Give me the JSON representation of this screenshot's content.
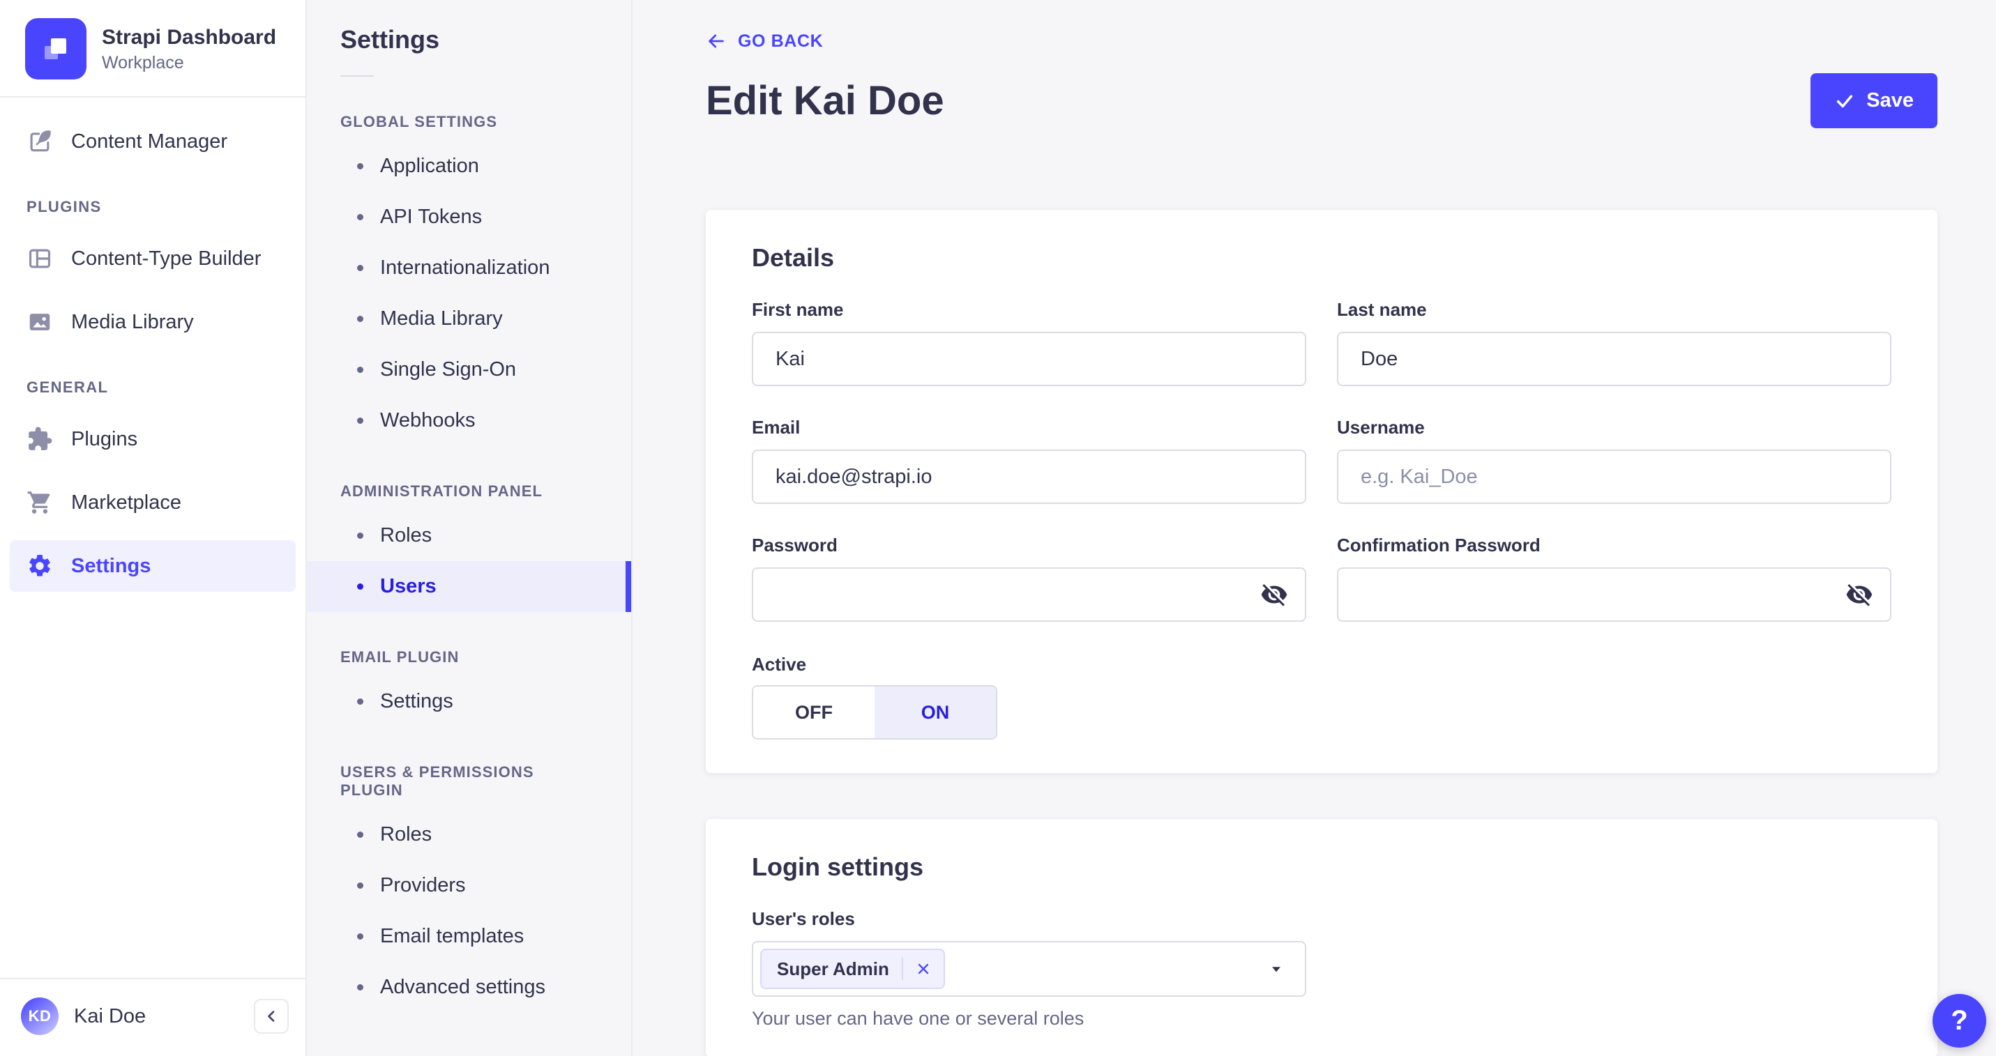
{
  "sidebar": {
    "brand": {
      "title": "Strapi Dashboard",
      "subtitle": "Workplace",
      "logo_icon": "strapi-logo"
    },
    "items": [
      {
        "label": "Content Manager",
        "icon": "feather-pen-icon"
      }
    ],
    "sections": [
      {
        "header": "PLUGINS",
        "items": [
          {
            "label": "Content-Type Builder",
            "icon": "layout-icon"
          },
          {
            "label": "Media Library",
            "icon": "picture-icon"
          }
        ]
      },
      {
        "header": "GENERAL",
        "items": [
          {
            "label": "Plugins",
            "icon": "puzzle-icon"
          },
          {
            "label": "Marketplace",
            "icon": "cart-icon"
          },
          {
            "label": "Settings",
            "icon": "gear-icon",
            "active": true
          }
        ]
      }
    ],
    "user": {
      "name": "Kai Doe",
      "initials": "KD"
    },
    "collapse_icon": "chevron-left-icon"
  },
  "subnav": {
    "title": "Settings",
    "sections": [
      {
        "header": "GLOBAL SETTINGS",
        "items": [
          "Application",
          "API Tokens",
          "Internationalization",
          "Media Library",
          "Single Sign-On",
          "Webhooks"
        ]
      },
      {
        "header": "ADMINISTRATION PANEL",
        "items": [
          "Roles",
          "Users"
        ],
        "active_item": "Users"
      },
      {
        "header": "EMAIL PLUGIN",
        "items": [
          "Settings"
        ]
      },
      {
        "header": "USERS & PERMISSIONS PLUGIN",
        "items": [
          "Roles",
          "Providers",
          "Email templates",
          "Advanced settings"
        ]
      }
    ]
  },
  "header": {
    "go_back_label": "GO BACK",
    "title": "Edit Kai Doe",
    "save_label": "Save"
  },
  "details_card": {
    "heading": "Details",
    "fields": [
      {
        "label": "First name",
        "value": "Kai"
      },
      {
        "label": "Last name",
        "value": "Doe"
      },
      {
        "label": "Email",
        "value": "kai.doe@strapi.io"
      },
      {
        "label": "Username",
        "value": "",
        "placeholder": "e.g. Kai_Doe"
      },
      {
        "label": "Password",
        "value": "",
        "icon": "eye-off-icon"
      },
      {
        "label": "Confirmation Password",
        "value": "",
        "icon": "eye-off-icon"
      }
    ],
    "active_toggle": {
      "label": "Active",
      "off": "OFF",
      "on": "ON",
      "selected": "ON"
    }
  },
  "login_card": {
    "heading": "Login settings",
    "roles_label": "User's roles",
    "selected_role": "Super Admin",
    "remove_role_icon": "close-icon",
    "dropdown_icon": "caret-down-icon",
    "helper": "Your user can have one or several roles"
  },
  "help_button": {
    "label": "?"
  },
  "colors": {
    "primary": "#4945FF",
    "primary_dark": "#271FE0",
    "primary_light_bg": "#F0F0FF",
    "toggle_on_bg": "#EDEDFC",
    "chip_border": "#D9D8FF",
    "text": "#32324D",
    "text_muted": "#666687",
    "icon_muted": "#8E8EA9",
    "input_border": "#DCDCE4",
    "panel_border": "#EAEAEF",
    "background": "#F6F6F9",
    "surface": "#FFFFFF"
  }
}
